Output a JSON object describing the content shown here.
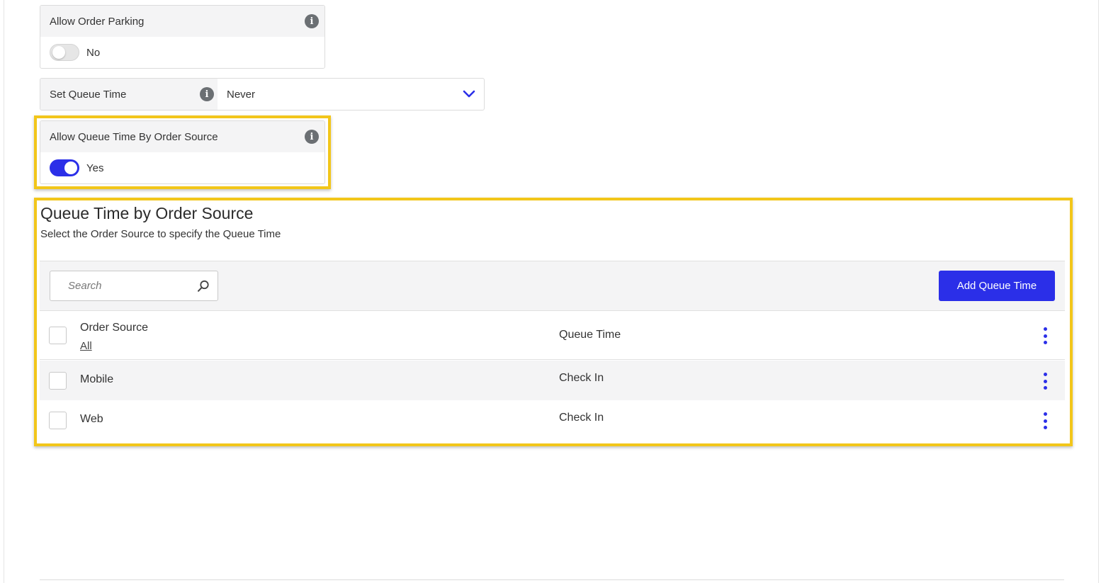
{
  "allow_order_parking": {
    "label": "Allow Order Parking",
    "toggle_value": "No",
    "icon": "info-icon"
  },
  "set_queue_time": {
    "label": "Set Queue Time",
    "selected": "Never",
    "icon": "info-icon"
  },
  "allow_queue_time_by_source": {
    "label": "Allow Queue Time By Order Source",
    "toggle_value": "Yes",
    "icon": "info-icon"
  },
  "queue_section": {
    "title": "Queue Time by Order Source",
    "subtitle": "Select the Order Source to specify the Queue Time",
    "search_placeholder": "Search",
    "add_button": "Add Queue Time",
    "table": {
      "col_source": "Order Source",
      "filter_all": "All",
      "col_queue": "Queue Time",
      "rows": [
        {
          "source": "Mobile",
          "queue_time": "Check In"
        },
        {
          "source": "Web",
          "queue_time": "Check In"
        }
      ]
    }
  },
  "colors": {
    "accent": "#2b2fe8",
    "highlight": "#f2c61a",
    "panel_bg": "#f4f4f5"
  }
}
